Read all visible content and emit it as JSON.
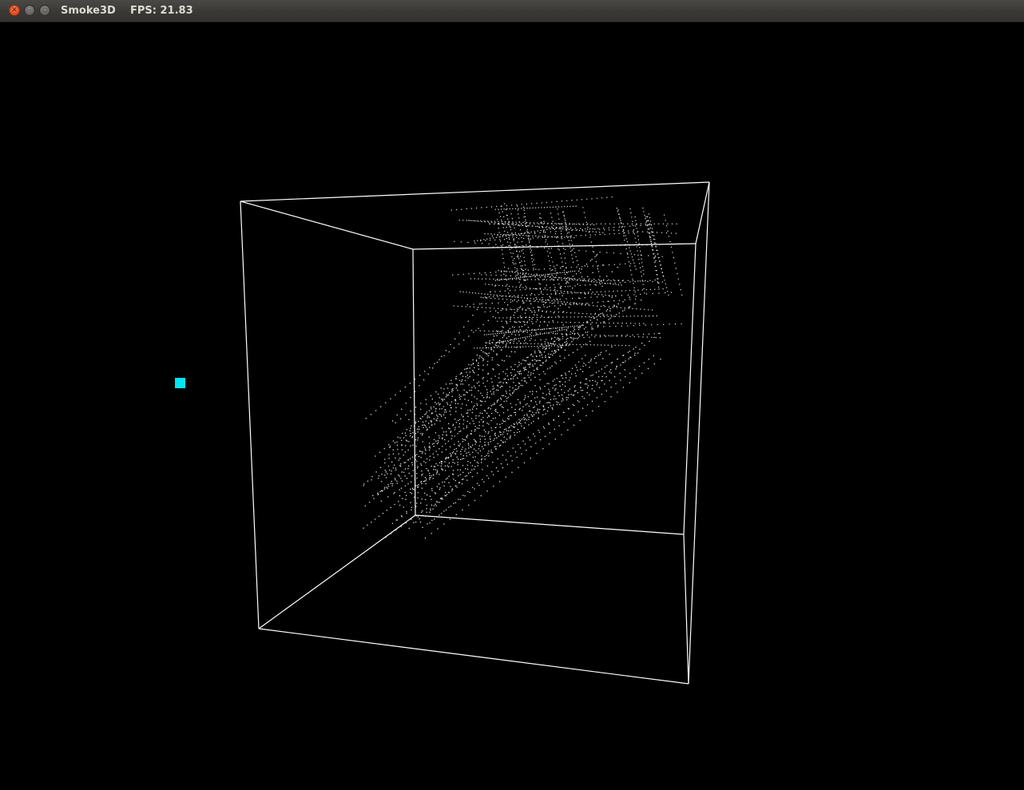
{
  "window": {
    "title": "Smoke3D",
    "fps_label": "FPS: 21.83"
  },
  "titlebar_icons": {
    "close": "close-icon",
    "minimize": "minimize-icon",
    "maximize": "maximize-icon"
  },
  "colors": {
    "background": "#000000",
    "wireframe": "#ffffff",
    "smoke_particles": "#d8d8d8",
    "source_marker": "#00e5f0",
    "close_button": "#e0461c"
  }
}
